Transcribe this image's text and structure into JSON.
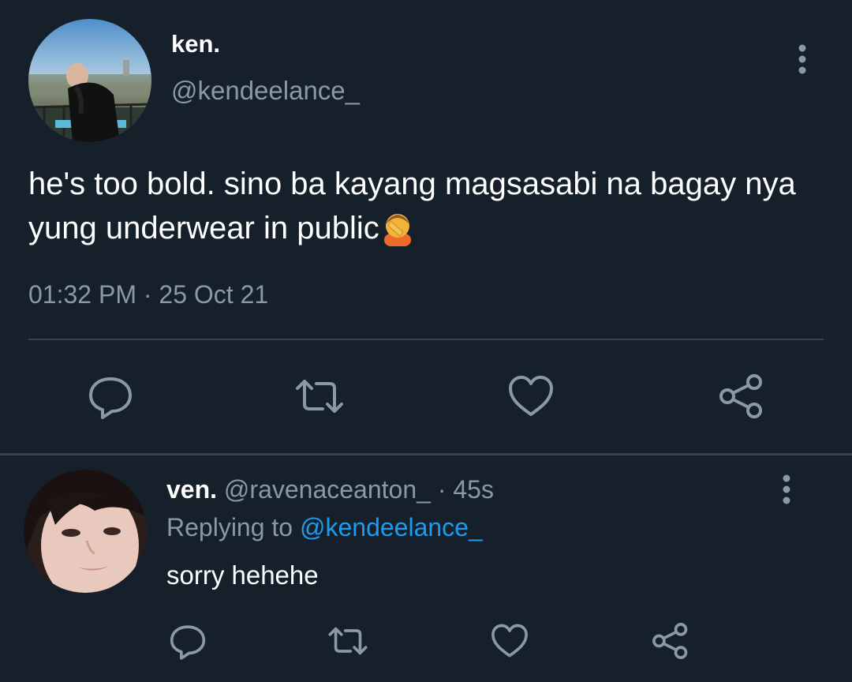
{
  "tweet": {
    "display_name": "ken.",
    "handle": "@kendeelance_",
    "text": "he's too bold. sino ba kayang magsasabi na bagay nya yung underwear in public",
    "emoji": "facepalm-emoji",
    "time": "01:32 PM",
    "separator": " · ",
    "date": "25 Oct 21",
    "actions": [
      "reply-icon",
      "retweet-icon",
      "like-icon",
      "share-icon"
    ]
  },
  "reply": {
    "display_name": "ven.",
    "handle": "@ravenaceanton_",
    "age": "· 45s",
    "replying_prefix": "Replying to ",
    "replying_to": "@kendeelance_",
    "text": "sorry hehehe",
    "actions": [
      "reply-icon",
      "retweet-icon",
      "like-icon",
      "share-icon"
    ]
  },
  "colors": {
    "background": "#15202b",
    "secondary_text": "#8b98a5",
    "link": "#1d9bf0",
    "divider": "#38444d"
  }
}
